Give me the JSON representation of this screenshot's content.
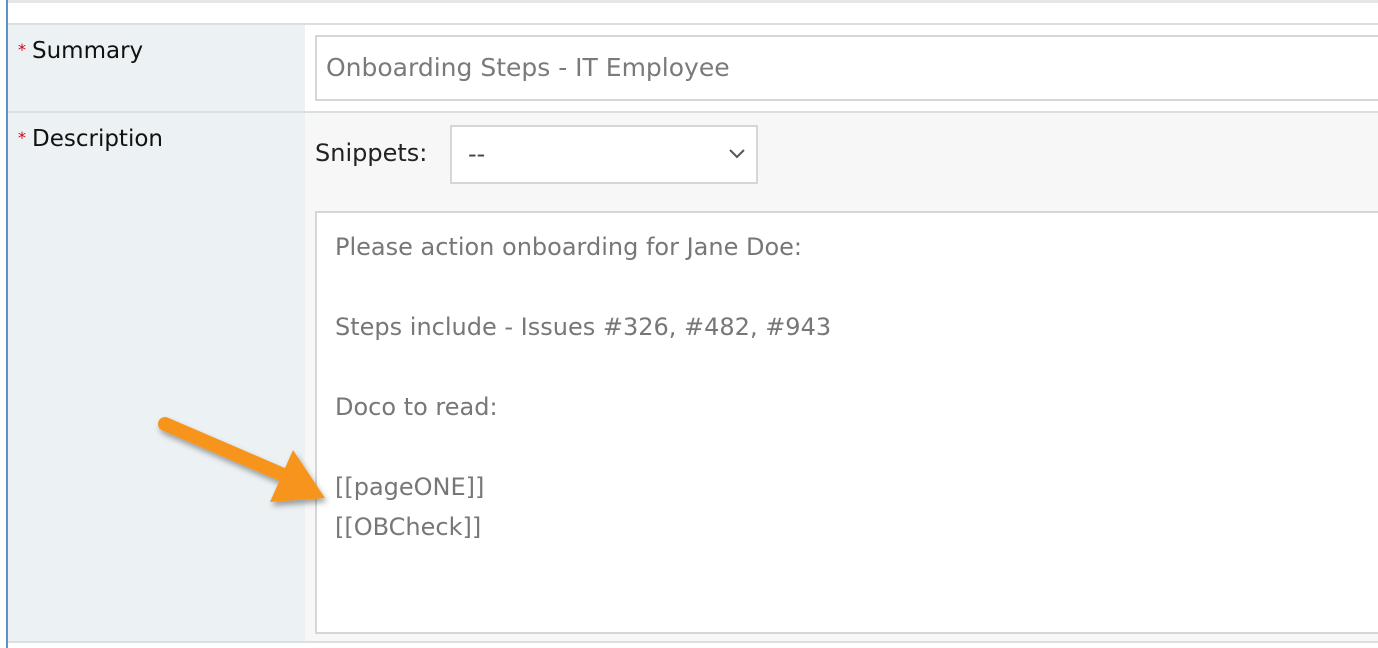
{
  "form": {
    "summary": {
      "label": "Summary",
      "required_mark": "*",
      "value": "Onboarding Steps - IT Employee"
    },
    "description": {
      "label": "Description",
      "required_mark": "*",
      "snippets_label": "Snippets:",
      "snippets_selected": "--",
      "lines": [
        "Please action onboarding for Jane Doe:",
        "",
        "Steps include - Issues #326, #482, #943",
        "",
        "Doco to read:",
        "",
        "[[pageONE]]",
        "[[OBCheck]]"
      ]
    }
  },
  "annotation": {
    "icon": "arrow-icon",
    "color": "#f7941d"
  }
}
